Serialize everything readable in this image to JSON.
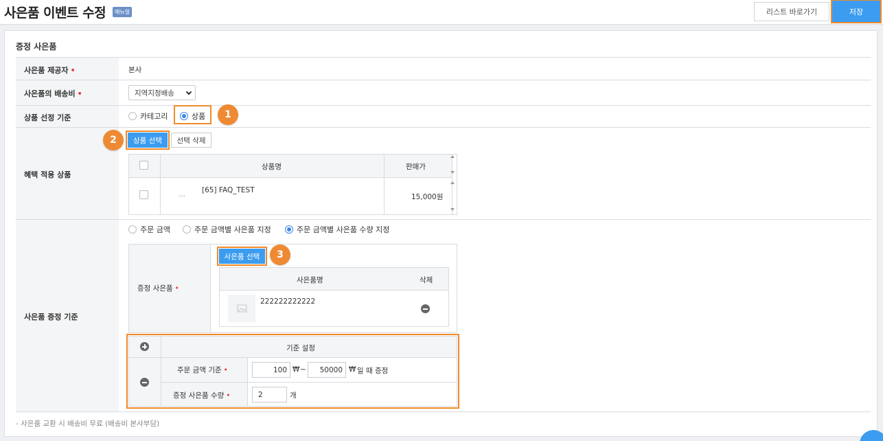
{
  "header": {
    "title": "사은품 이벤트 수정",
    "manual_badge": "매뉴얼",
    "list_button": "리스트 바로가기",
    "save_button": "저장"
  },
  "section_title": "증정 사은품",
  "provider": {
    "label": "사은품 제공자",
    "value": "본사"
  },
  "shipping": {
    "label": "사은품의 배송비",
    "selected": "지역지정배송"
  },
  "criteria": {
    "label": "상품 선정 기준",
    "options": [
      "카테고리",
      "상품"
    ],
    "selected": "상품"
  },
  "benefit_products": {
    "label": "혜택 적용 상품",
    "select_button": "상품 선택",
    "delete_button": "선택 삭제",
    "columns": [
      "상품명",
      "판매가"
    ],
    "rows": [
      {
        "thumb_text": "...",
        "name": "[65] FAQ_TEST",
        "price": "15,000원"
      }
    ]
  },
  "gift_criteria": {
    "label": "사은품 증정 기준",
    "options": [
      "주문 금액",
      "주문 금액별 사은품 지정",
      "주문 금액별 사은품 수량 지정"
    ],
    "selected": "주문 금액별 사은품 수량 지정",
    "gift_label": "증정 사은품",
    "gift_select_button": "사은품 선택",
    "gift_columns": [
      "사은품명",
      "삭제"
    ],
    "gift_rows": [
      {
        "name": "222222222222"
      }
    ],
    "standard_header": "기준 설정",
    "order_amount_label": "주문 금액 기준",
    "min_amount": "100",
    "max_amount": "50000",
    "currency": "₩",
    "tilde": "~",
    "amount_suffix": "일 때 증정",
    "qty_label": "증정 사은품 수량",
    "qty_value": "2",
    "qty_unit": "개"
  },
  "footnote": "- 사은품 교환 시 배송비 무료 (배송비 본사부담)",
  "step_badges": [
    "1",
    "2",
    "3"
  ],
  "colors": {
    "primary": "#3b9cf0",
    "highlight": "#f08a2a",
    "required": "#e8343a"
  }
}
